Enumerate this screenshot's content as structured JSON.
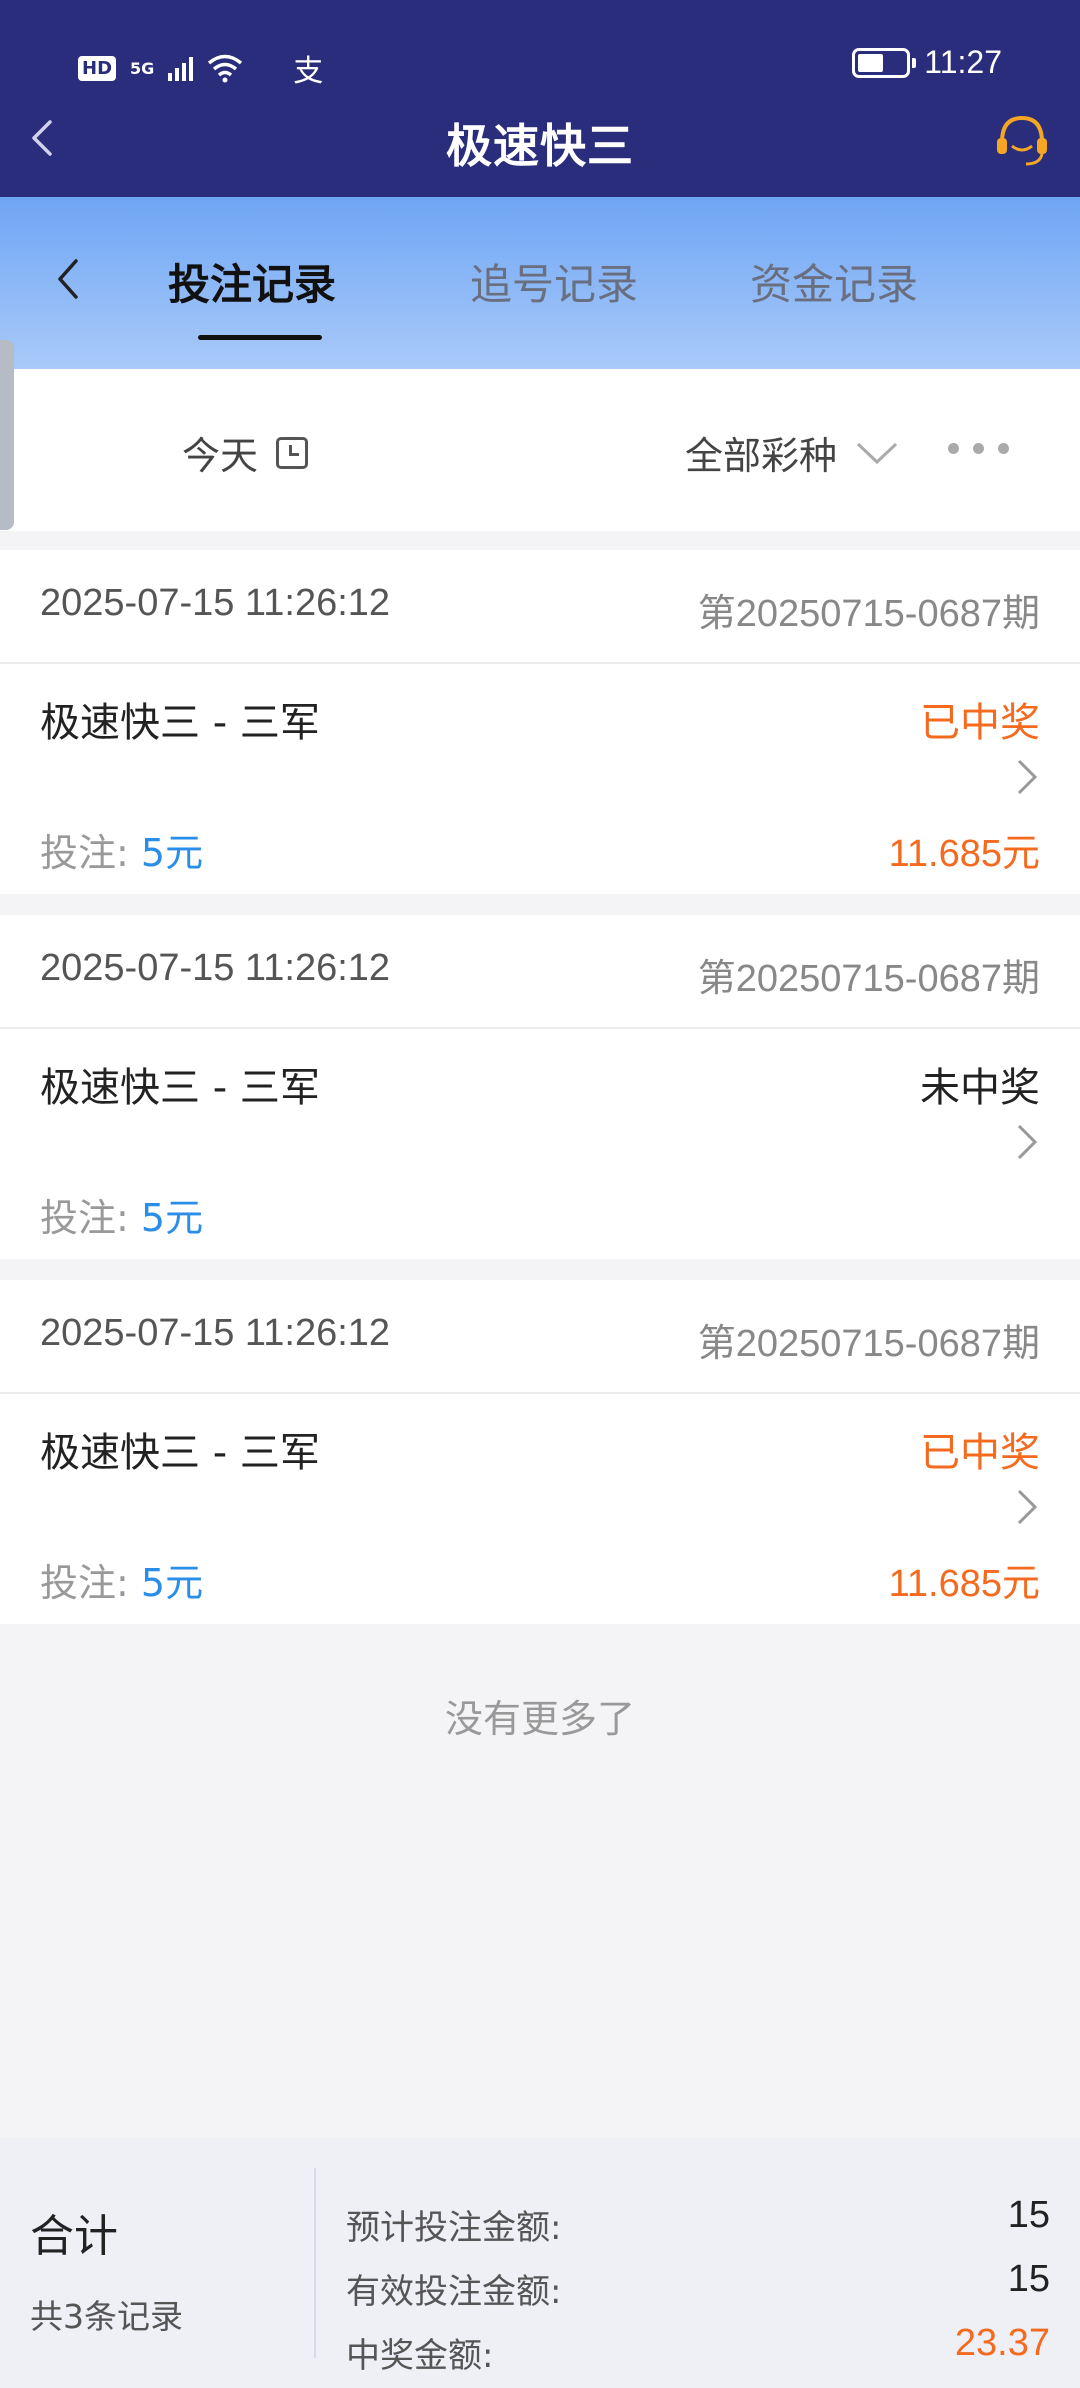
{
  "status_bar": {
    "hd": "HD",
    "network": "5G",
    "pay_icon": "支",
    "time": "11:27",
    "battery_level_fraction": 0.55
  },
  "header": {
    "title": "极速快三"
  },
  "tabs": [
    {
      "label": "投注记录",
      "active": true
    },
    {
      "label": "追号记录",
      "active": false
    },
    {
      "label": "资金记录",
      "active": false
    }
  ],
  "filter": {
    "date": "今天",
    "lottery_type": "全部彩种"
  },
  "records": [
    {
      "time": "2025-07-15 11:26:12",
      "period": "第20250715-0687期",
      "name": "极速快三 - 三军",
      "status": "已中奖",
      "bet_label": "投注:",
      "bet_amount": "5元",
      "prize": "11.685元"
    },
    {
      "time": "2025-07-15 11:26:12",
      "period": "第20250715-0687期",
      "name": "极速快三 - 三军",
      "status": "未中奖",
      "bet_label": "投注:",
      "bet_amount": "5元",
      "prize": ""
    },
    {
      "time": "2025-07-15 11:26:12",
      "period": "第20250715-0687期",
      "name": "极速快三 - 三军",
      "status": "已中奖",
      "bet_label": "投注:",
      "bet_amount": "5元",
      "prize": "11.685元"
    }
  ],
  "no_more": "没有更多了",
  "footer": {
    "total_label": "合计",
    "count_label": "共3条记录",
    "rows": [
      {
        "label": "预计投注金额:",
        "value": "15"
      },
      {
        "label": "有效投注金额:",
        "value": "15"
      },
      {
        "label": "中奖金额:",
        "value": "23.37"
      }
    ]
  },
  "colors": {
    "header_bg": "#2a2d7c",
    "win": "#f46a1f",
    "bet_amount": "#2a8de8"
  }
}
